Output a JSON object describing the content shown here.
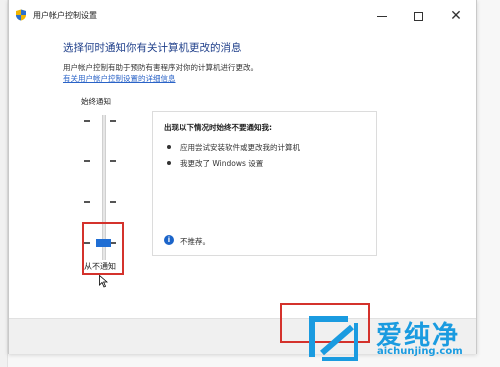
{
  "window": {
    "title": "用户帐户控制设置"
  },
  "main": {
    "heading": "选择何时通知你有关计算机更改的消息",
    "description": "用户帐户控制有助于预防有害程序对你的计算机进行更改。",
    "link": "有关用户帐户控制设置的详细信息"
  },
  "slider": {
    "top_label": "始终通知",
    "bottom_label": "从不通知",
    "level": 0,
    "levels": 4
  },
  "panel": {
    "title": "出现以下情况时始终不要通知我:",
    "items": [
      "应用尝试安装软件或更改我的计算机",
      "我更改了 Windows 设置"
    ],
    "note": "不推荐。"
  },
  "watermark": {
    "brand": "爱纯净",
    "url": "aichunjing.com"
  },
  "colors": {
    "heading": "#1f3f8a",
    "link": "#2a63c7",
    "thumb": "#1f6ed4",
    "highlight": "#d4322c",
    "watermark": "#1a9be0"
  }
}
